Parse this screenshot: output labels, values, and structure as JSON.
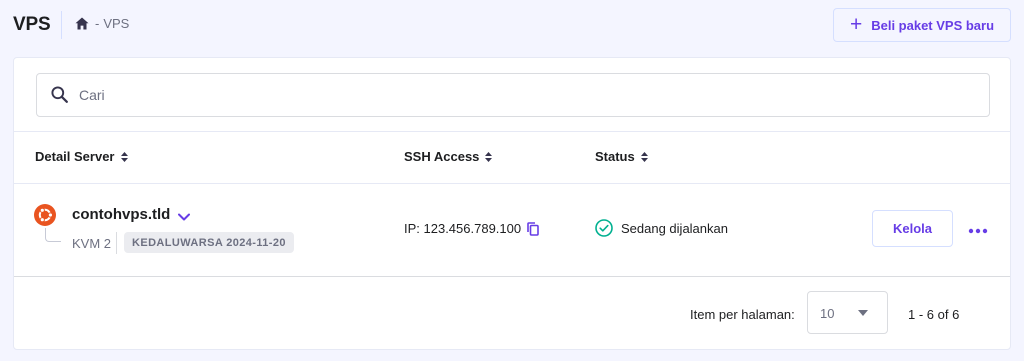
{
  "header": {
    "title": "VPS",
    "breadcrumb_current": "VPS",
    "breadcrumb_separator": "-",
    "buy_button_label": "Beli paket VPS baru"
  },
  "search": {
    "placeholder": "Cari",
    "value": ""
  },
  "table": {
    "columns": [
      "Detail Server",
      "SSH Access",
      "Status"
    ],
    "rows": [
      {
        "os_icon": "ubuntu-icon",
        "name": "contohvps.tld",
        "plan": "KVM 2",
        "expiry_badge": "KEDALUWARSA 2024-11-20",
        "ssh": "IP: 123.456.789.100",
        "status": "Sedang dijalankan",
        "manage_label": "Kelola"
      }
    ]
  },
  "pagination": {
    "per_page_label": "Item per halaman:",
    "per_page_value": "10",
    "range": "1 - 6 of 6"
  },
  "colors": {
    "accent": "#673de6",
    "status_ok": "#00b090",
    "ubuntu": "#e95420",
    "page_bg": "#f4f5ff"
  }
}
